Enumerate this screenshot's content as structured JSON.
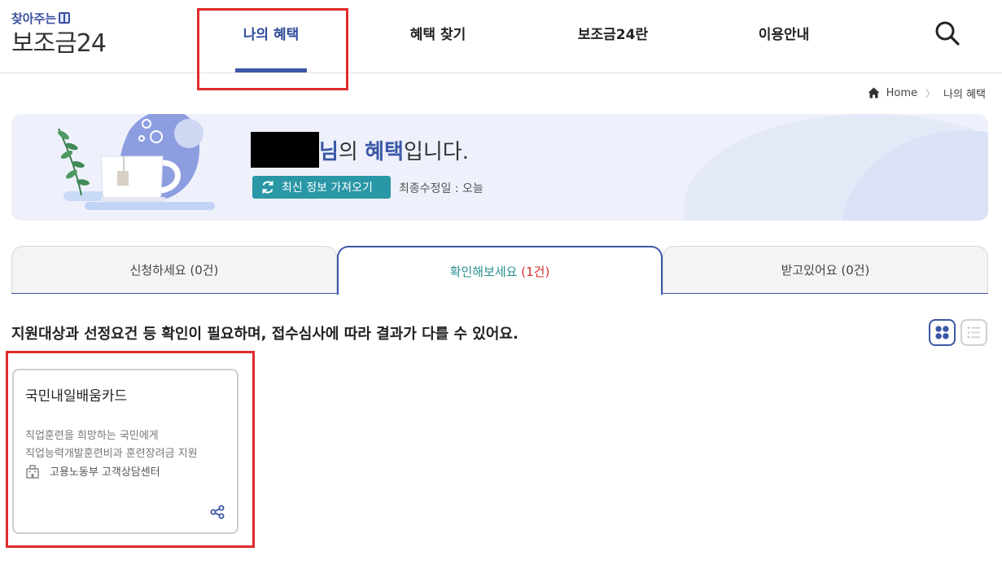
{
  "header": {
    "logo_top": "찾아주는",
    "logo_main": "보조금24",
    "nav": [
      "나의 혜택",
      "혜택 찾기",
      "보조금24란",
      "이용안내"
    ],
    "active_nav": "나의 혜택"
  },
  "breadcrumb": {
    "home": "Home",
    "current": "나의 혜택"
  },
  "hero": {
    "name_suffix": "님",
    "title_mid": "의 ",
    "title_em": "혜택",
    "title_end": "입니다.",
    "refresh_label": "최신 정보 가져오기",
    "updated_label": "최종수정일 : 오늘"
  },
  "tabs": [
    {
      "label": "신청하세요",
      "count": "(0건)"
    },
    {
      "label": "확인해보세요",
      "count": "(1건)"
    },
    {
      "label": "받고있어요",
      "count": "(0건)"
    }
  ],
  "description": "지원대상과 선정요건 등 확인이 필요하며, 접수심사에 따라 결과가 다를 수 있어요.",
  "cards": [
    {
      "title": "국민내일배움카드",
      "desc_line1": "직업훈련을 희망하는 국민에게",
      "desc_line2": "직업능력개발훈련비과 훈련장려금 지원",
      "org": "고용노동부 고객상담센터"
    }
  ],
  "colors": {
    "brand": "#3b58a6",
    "teal": "#2a97a6",
    "alert": "#d9302a",
    "annotation": "#e02b2b"
  },
  "icons": [
    "search-icon",
    "home-icon",
    "refresh-icon",
    "grid-view-icon",
    "list-view-icon",
    "building-icon",
    "share-icon"
  ]
}
